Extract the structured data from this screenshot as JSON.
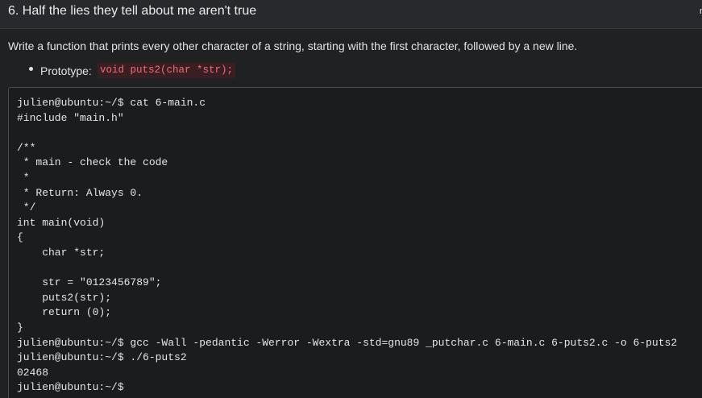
{
  "task": {
    "title": "6. Half the lies they tell about me aren't true",
    "header_right_text": "m"
  },
  "description": "Write a function that prints every other character of a string, starting with the first character, followed by a new line.",
  "prototype": {
    "label": "Prototype:",
    "code": "void puts2(char *str);"
  },
  "terminal": {
    "text": "julien@ubuntu:~/$ cat 6-main.c\n#include \"main.h\"\n\n/**\n * main - check the code\n *\n * Return: Always 0.\n */\nint main(void)\n{\n    char *str;\n\n    str = \"0123456789\";\n    puts2(str);\n    return (0);\n}\njulien@ubuntu:~/$ gcc -Wall -pedantic -Werror -Wextra -std=gnu89 _putchar.c 6-main.c 6-puts2.c -o 6-puts2\njulien@ubuntu:~/$ ./6-puts2\n02468\njulien@ubuntu:~/$"
  }
}
